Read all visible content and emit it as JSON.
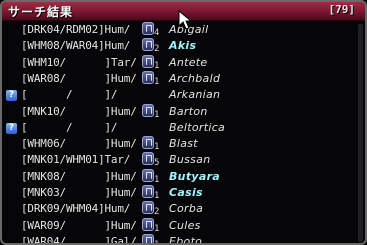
{
  "window": {
    "title": "サーチ結果",
    "count": "[79]"
  },
  "rows": [
    {
      "jobs": "[DRK04/RDM02]",
      "race": "Hum",
      "ls_num": "4",
      "name": "Abigail",
      "highlight": false,
      "question": false,
      "has_ls": true
    },
    {
      "jobs": "[WHM08/WAR04]",
      "race": "Hum",
      "ls_num": "2",
      "name": "Akis",
      "highlight": true,
      "question": false,
      "has_ls": true
    },
    {
      "jobs": "[WHM10/      ]",
      "race": "Tar",
      "ls_num": "1",
      "name": "Antete",
      "highlight": false,
      "question": false,
      "has_ls": true
    },
    {
      "jobs": "[WAR08/      ]",
      "race": "Hum",
      "ls_num": "1",
      "name": "Archbald",
      "highlight": false,
      "question": false,
      "has_ls": true
    },
    {
      "jobs": "[      /     ]",
      "race": "",
      "ls_num": "",
      "name": "Arkanian",
      "highlight": false,
      "question": true,
      "has_ls": false
    },
    {
      "jobs": "[MNK10/      ]",
      "race": "Hum",
      "ls_num": "1",
      "name": "Barton",
      "highlight": false,
      "question": false,
      "has_ls": true
    },
    {
      "jobs": "[      /     ]",
      "race": "",
      "ls_num": "",
      "name": "Beltortica",
      "highlight": false,
      "question": true,
      "has_ls": false
    },
    {
      "jobs": "[WHM06/      ]",
      "race": "Hum",
      "ls_num": "1",
      "name": "Blast",
      "highlight": false,
      "question": false,
      "has_ls": true
    },
    {
      "jobs": "[MNK01/WHM01]",
      "race": "Tar",
      "ls_num": "5",
      "name": "Bussan",
      "highlight": false,
      "question": false,
      "has_ls": true
    },
    {
      "jobs": "[MNK08/      ]",
      "race": "Hum",
      "ls_num": "1",
      "name": "Butyara",
      "highlight": true,
      "question": false,
      "has_ls": true
    },
    {
      "jobs": "[MNK03/      ]",
      "race": "Hum",
      "ls_num": "1",
      "name": "Casis",
      "highlight": true,
      "question": false,
      "has_ls": true
    },
    {
      "jobs": "[DRK09/WHM04]",
      "race": "Hum",
      "ls_num": "2",
      "name": "Corba",
      "highlight": false,
      "question": false,
      "has_ls": true
    },
    {
      "jobs": "[WAR09/      ]",
      "race": "Hum",
      "ls_num": "1",
      "name": "Cules",
      "highlight": false,
      "question": false,
      "has_ls": true
    },
    {
      "jobs": "[WAR04/      ]",
      "race": "Gal",
      "ls_num": "1",
      "name": "Eboto",
      "highlight": false,
      "question": false,
      "has_ls": true
    }
  ],
  "colors": {
    "title_bar": "#7a1630",
    "name_highlight": "#9ef5ff",
    "text": "#e6e6e6"
  }
}
